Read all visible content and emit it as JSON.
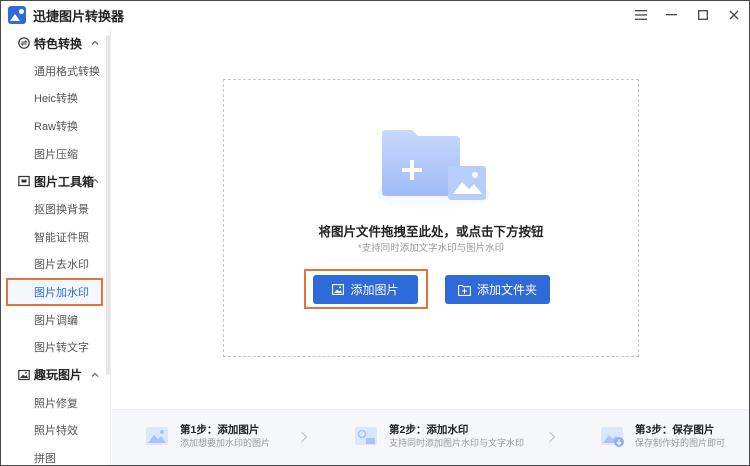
{
  "app": {
    "title": "迅捷图片转换器"
  },
  "window_controls": [
    "menu-icon",
    "minimize-icon",
    "maximize-icon",
    "close-icon"
  ],
  "sidebar": {
    "groups": [
      {
        "label": "特色转换",
        "icon": "convert-icon",
        "expanded": true,
        "items": [
          {
            "label": "通用格式转换"
          },
          {
            "label": "Heic转换"
          },
          {
            "label": "Raw转换"
          },
          {
            "label": "图片压缩"
          }
        ]
      },
      {
        "label": "图片工具箱",
        "icon": "toolbox-icon",
        "expanded": true,
        "items": [
          {
            "label": "抠图换背景"
          },
          {
            "label": "智能证件照"
          },
          {
            "label": "图片去水印"
          },
          {
            "label": "图片加水印",
            "active": true
          },
          {
            "label": "图片调编"
          },
          {
            "label": "图片转文字"
          }
        ]
      },
      {
        "label": "趣玩图片",
        "icon": "image-fun-icon",
        "expanded": true,
        "items": [
          {
            "label": "照片修复"
          },
          {
            "label": "照片特效"
          },
          {
            "label": "拼图"
          }
        ]
      }
    ]
  },
  "dropzone": {
    "title": "将图片文件拖拽至此处，或点击下方按钮",
    "subtitle": "*支持同时添加文字水印与图片水印",
    "add_image_label": "添加图片",
    "add_folder_label": "添加文件夹"
  },
  "steps": [
    {
      "title": "第1步：添加图片",
      "desc": "添加想要加水印的图片"
    },
    {
      "title": "第2步：添加水印",
      "desc": "支持同时添加图片水印与文字水印"
    },
    {
      "title": "第3步：保存图片",
      "desc": "保存制作好的图片即可"
    }
  ],
  "colors": {
    "accent": "#2f6bd8",
    "highlight": "#e8703a"
  }
}
